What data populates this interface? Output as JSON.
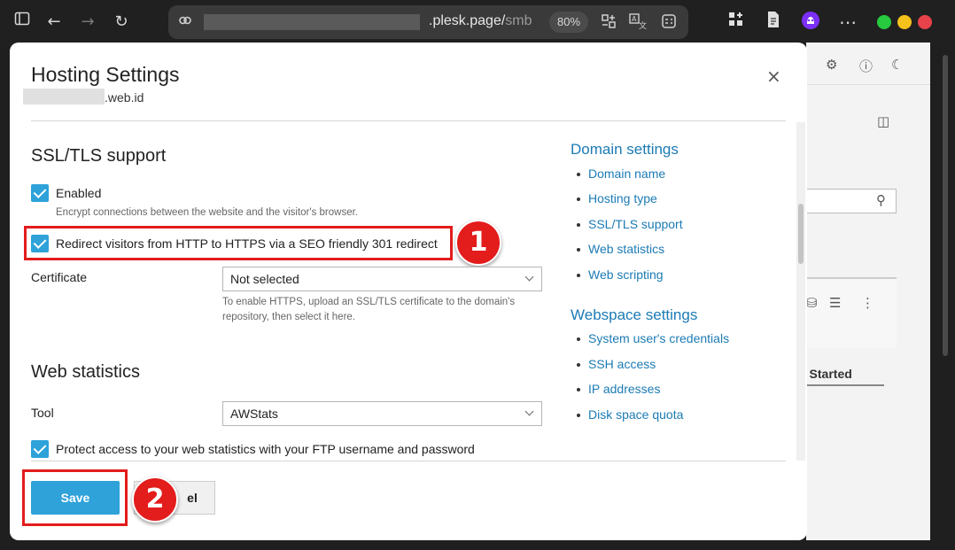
{
  "browser": {
    "url_visible": ".plesk.page/",
    "url_faded": "smb",
    "zoom": "80%",
    "icons": [
      "sidebar-icon",
      "back-icon",
      "forward-icon",
      "reload-icon",
      "link-icon",
      "grid-icon",
      "translate-icon",
      "reader-icon",
      "extensions-icon",
      "note-icon",
      "profile-icon",
      "more-icon"
    ],
    "window_colors": {
      "minimize": "#27c93f",
      "maximize": "#f5c21b",
      "close": "#e8434b"
    }
  },
  "background": {
    "getting_started": "t Started"
  },
  "modal": {
    "title": "Hosting Settings",
    "subdomain": ".web.id",
    "close_label": "×",
    "ssl": {
      "heading": "SSL/TLS support",
      "enabled_label": "Enabled",
      "enabled_hint": "Encrypt connections between the website and the visitor's browser.",
      "redirect_label": "Redirect visitors from HTTP to HTTPS via a SEO friendly 301 redirect",
      "certificate_label": "Certificate",
      "certificate_value": "Not selected",
      "certificate_hint": "To enable HTTPS, upload an SSL/TLS certificate to the domain's repository, then select it here."
    },
    "stats": {
      "heading": "Web statistics",
      "tool_label": "Tool",
      "tool_value": "AWStats",
      "protect_label": "Protect access to your web statistics with your FTP username and password"
    },
    "nav": {
      "domain_heading": "Domain settings",
      "domain_items": [
        "Domain name",
        "Hosting type",
        "SSL/TLS support",
        "Web statistics",
        "Web scripting"
      ],
      "webspace_heading": "Webspace settings",
      "webspace_items": [
        "System user's credentials",
        "SSH access",
        "IP addresses",
        "Disk space quota"
      ]
    },
    "buttons": {
      "save": "Save",
      "cancel": "el"
    }
  },
  "annotations": {
    "badge1": "1",
    "badge2": "2",
    "color": "#e31c1c"
  },
  "accent": "#2ea2d9",
  "link_color": "#1c7bb5"
}
